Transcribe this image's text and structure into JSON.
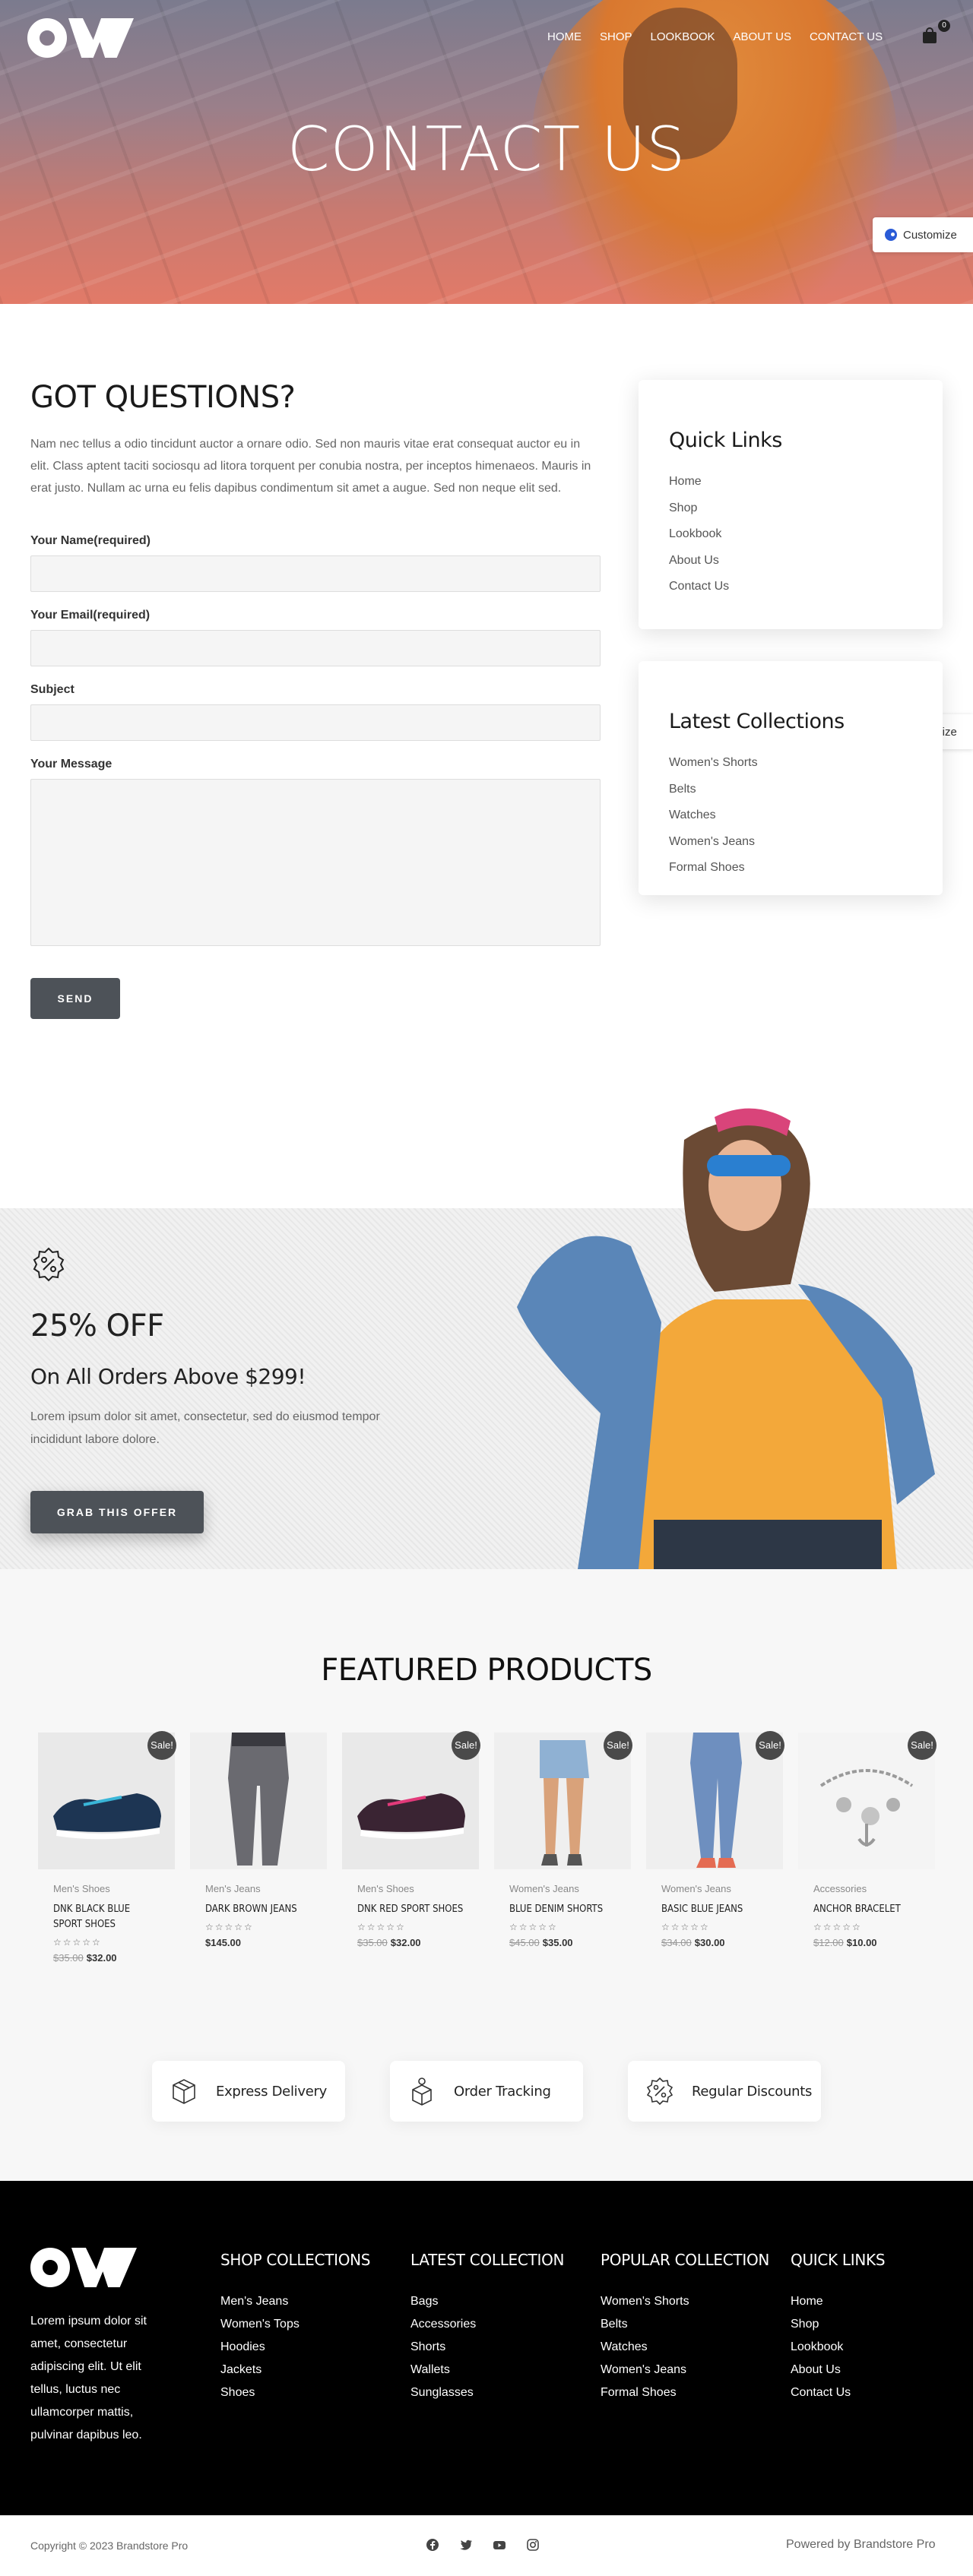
{
  "header": {
    "nav": [
      "HOME",
      "SHOP",
      "LOOKBOOK",
      "ABOUT US",
      "CONTACT US"
    ],
    "cart_count": "0",
    "hero_title": "CONTACT US"
  },
  "customize_label": "Customize",
  "contact": {
    "title": "GOT QUESTIONS?",
    "intro": "Nam nec tellus a odio tincidunt auctor a ornare odio. Sed non mauris vitae erat consequat auctor eu in elit. Class aptent taciti sociosqu ad litora torquent per conubia nostra, per inceptos himenaeos. Mauris in erat justo. Nullam ac urna eu felis dapibus condimentum sit amet a augue. Sed non neque elit sed.",
    "name_label": "Your Name(required)",
    "email_label": "Your Email(required)",
    "subject_label": "Subject",
    "message_label": "Your Message",
    "send_label": "SEND"
  },
  "quick_links": {
    "title": "Quick Links",
    "items": [
      "Home",
      "Shop",
      "Lookbook",
      "About Us",
      "Contact Us"
    ]
  },
  "latest_collections": {
    "title": "Latest Collections",
    "items": [
      "Women's Shorts",
      "Belts",
      "Watches",
      "Women's Jeans",
      "Formal Shoes"
    ]
  },
  "promo": {
    "title": "25% OFF",
    "subtitle": "On All Orders Above $299!",
    "text": "Lorem ipsum dolor sit amet, consectetur, sed do eiusmod tempor incididunt labore dolore.",
    "button": "GRAB THIS OFFER"
  },
  "featured": {
    "title": "FEATURED PRODUCTS",
    "sale_label": "Sale!",
    "stars": "☆☆☆☆☆",
    "products": [
      {
        "category": "Men's Shoes",
        "name": "DNK BLACK BLUE SPORT SHOES",
        "old_price": "$35.00",
        "price": "$32.00",
        "sale": true
      },
      {
        "category": "Men's Jeans",
        "name": "DARK BROWN JEANS",
        "old_price": "",
        "price": "$145.00",
        "sale": false
      },
      {
        "category": "Men's Shoes",
        "name": "DNK RED SPORT SHOES",
        "old_price": "$35.00",
        "price": "$32.00",
        "sale": true
      },
      {
        "category": "Women's Jeans",
        "name": "BLUE DENIM SHORTS",
        "old_price": "$45.00",
        "price": "$35.00",
        "sale": true
      },
      {
        "category": "Women's Jeans",
        "name": "BASIC BLUE JEANS",
        "old_price": "$34.00",
        "price": "$30.00",
        "sale": true
      },
      {
        "category": "Accessories",
        "name": "ANCHOR BRACELET",
        "old_price": "$12.00",
        "price": "$10.00",
        "sale": true
      }
    ]
  },
  "features": [
    "Express Delivery",
    "Order Tracking",
    "Regular Discounts"
  ],
  "footer": {
    "about": "Lorem ipsum dolor sit amet, consectetur adipiscing elit. Ut elit tellus, luctus nec ullamcorper mattis, pulvinar dapibus leo.",
    "columns": [
      {
        "title": "SHOP COLLECTIONS",
        "items": [
          "Men's Jeans",
          "Women's Tops",
          "Hoodies",
          "Jackets",
          "Shoes"
        ]
      },
      {
        "title": "LATEST COLLECTION",
        "items": [
          "Bags",
          "Accessories",
          "Shorts",
          "Wallets",
          "Sunglasses"
        ]
      },
      {
        "title": "POPULAR COLLECTION",
        "items": [
          "Women's Shorts",
          "Belts",
          "Watches",
          "Women's Jeans",
          "Formal Shoes"
        ]
      },
      {
        "title": "QUICK LINKS",
        "items": [
          "Home",
          "Shop",
          "Lookbook",
          "About Us",
          "Contact Us"
        ]
      }
    ],
    "copyright": "Copyright © 2023 Brandstore Pro",
    "powered": "Powered by Brandstore Pro"
  }
}
